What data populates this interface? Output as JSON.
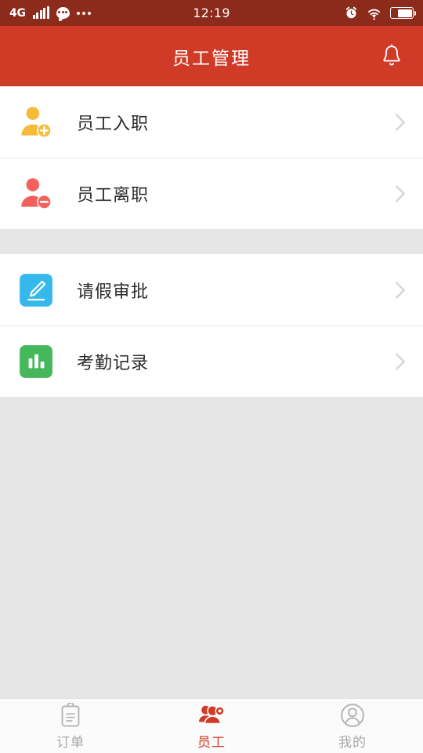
{
  "statusbar": {
    "network": "4G",
    "time": "12:19",
    "icons": [
      "signal-bars-icon",
      "chat-bubble-icon",
      "more-dots-icon",
      "alarm-clock-icon",
      "wifi-icon",
      "battery-icon"
    ]
  },
  "header": {
    "title": "员工管理",
    "bell_icon": "bell-icon"
  },
  "groups": [
    {
      "items": [
        {
          "label": "员工入职",
          "icon": "user-add-icon",
          "color": "#F5BC3B",
          "chevron": "chevron-right-icon"
        },
        {
          "label": "员工离职",
          "icon": "user-remove-icon",
          "color": "#F4615C",
          "chevron": "chevron-right-icon"
        }
      ]
    },
    {
      "items": [
        {
          "label": "请假审批",
          "icon": "pencil-edit-icon",
          "color": "#35B9EC",
          "chevron": "chevron-right-icon"
        },
        {
          "label": "考勤记录",
          "icon": "bar-chart-icon",
          "color": "#45B85C",
          "chevron": "chevron-right-icon"
        }
      ]
    }
  ],
  "tabbar": {
    "tabs": [
      {
        "label": "订单",
        "icon": "clipboard-icon",
        "active": false
      },
      {
        "label": "员工",
        "icon": "people-gear-icon",
        "active": true
      },
      {
        "label": "我的",
        "icon": "person-circle-icon",
        "active": false
      }
    ],
    "active_color": "#D03B28",
    "inactive_color": "#A8A8A8"
  },
  "colors": {
    "statusbar_bg": "#8C2A1C",
    "header_bg": "#D03B28",
    "page_bg": "#E6E6E6",
    "card_bg": "#FFFFFF"
  }
}
